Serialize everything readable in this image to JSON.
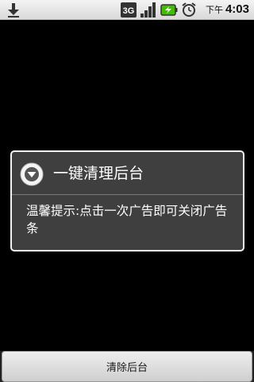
{
  "status_bar": {
    "ampm": "下午",
    "time": "4:03",
    "network_type": "3G",
    "icons": [
      "download-icon",
      "3g-icon",
      "signal-icon",
      "battery-charging-icon",
      "alarm-icon"
    ],
    "accent_green": "#3fbf00"
  },
  "dialog": {
    "icon": "dropdown-circle-icon",
    "title": "一键清理后台",
    "message": "温馨提示:点击一次广告即可关闭广告条"
  },
  "bottom": {
    "clear_label": "清除后台"
  }
}
